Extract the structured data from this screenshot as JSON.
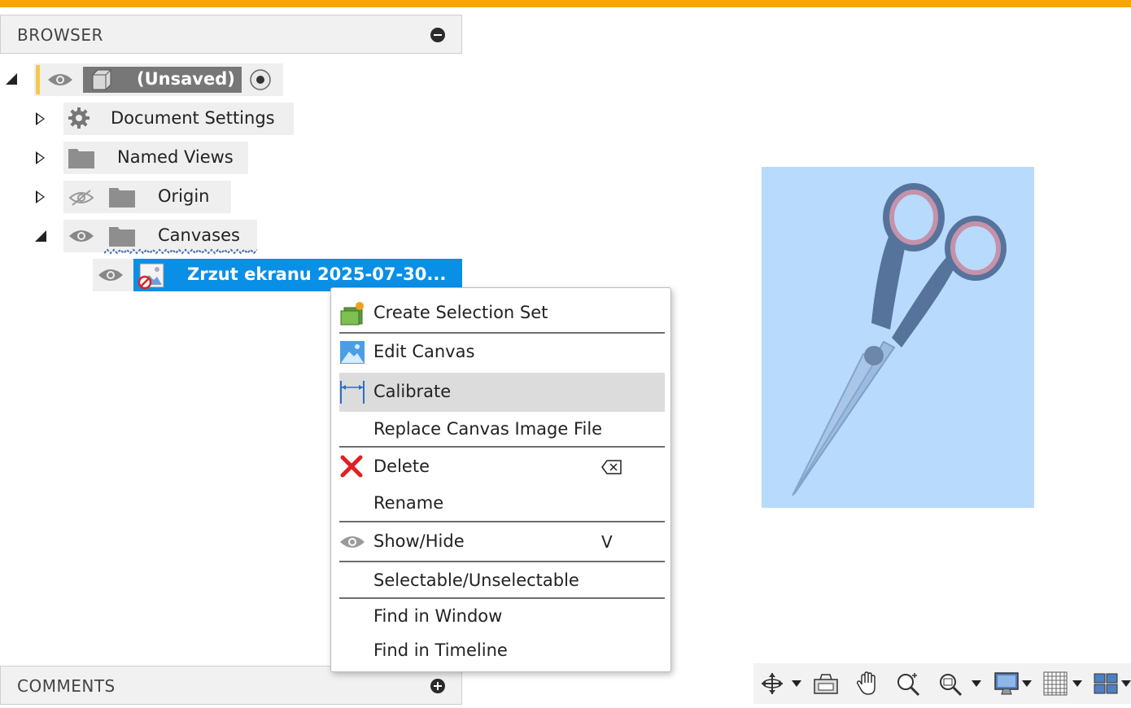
{
  "browser": {
    "title": "BROWSER",
    "root": {
      "label": "(Unsaved)"
    },
    "items": [
      {
        "label": "Document Settings"
      },
      {
        "label": "Named Views"
      },
      {
        "label": "Origin"
      },
      {
        "label": "Canvases"
      }
    ],
    "canvas_item": {
      "label": "Zrzut ekranu 2025-07-30..."
    }
  },
  "comments": {
    "title": "COMMENTS"
  },
  "context_menu": {
    "items": [
      {
        "label": "Create Selection Set",
        "icon": "selection-set-icon"
      },
      {
        "label": "Edit Canvas",
        "icon": "edit-canvas-icon"
      },
      {
        "label": "Calibrate",
        "icon": "calibrate-icon"
      },
      {
        "label": "Replace Canvas Image File"
      },
      {
        "label": "Delete",
        "icon": "delete-icon",
        "shortcut_icon": "backspace-key-icon"
      },
      {
        "label": "Rename"
      },
      {
        "label": "Show/Hide",
        "icon": "eye-icon",
        "shortcut": "V"
      },
      {
        "label": "Selectable/Unselectable"
      },
      {
        "label": "Find in Window"
      },
      {
        "label": "Find in Timeline"
      }
    ]
  },
  "toolbar": {
    "icons": [
      "orbit-icon",
      "look-at-icon",
      "pan-hand-icon",
      "zoom-icon",
      "fit-zoom-icon",
      "display-settings-icon",
      "grid-icon",
      "viewports-icon"
    ]
  },
  "colors": {
    "accent": "#f7a600",
    "selection": "#0a8fe6",
    "canvas_tint": "#b8dafc"
  }
}
